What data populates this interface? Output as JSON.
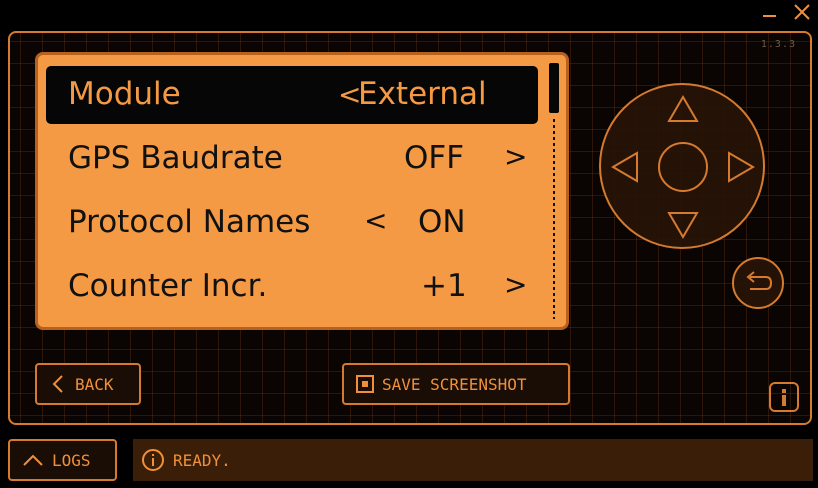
{
  "window": {
    "minimize_icon": "minimize-icon",
    "close_icon": "close-icon"
  },
  "app": {
    "version": "1.3.3"
  },
  "menu": {
    "rows": [
      {
        "label": "Module",
        "value": "External",
        "left_arrow": "<",
        "right_arrow": "",
        "selected": true
      },
      {
        "label": "GPS Baudrate",
        "value": "OFF",
        "left_arrow": "",
        "right_arrow": ">",
        "selected": false
      },
      {
        "label": "Protocol Names",
        "value": "ON",
        "left_arrow": "<",
        "right_arrow": "",
        "selected": false
      },
      {
        "label": "Counter Incr.",
        "value": "+1",
        "left_arrow": "",
        "right_arrow": ">",
        "selected": false
      }
    ]
  },
  "controls": {
    "back_label": "BACK",
    "save_label": "SAVE SCREENSHOT",
    "logs_label": "LOGS"
  },
  "status": {
    "text": "READY."
  },
  "colors": {
    "accent": "#f0903a",
    "screen": "#f59a44",
    "border": "#d57a2e",
    "status_bg": "#3a1e08"
  }
}
